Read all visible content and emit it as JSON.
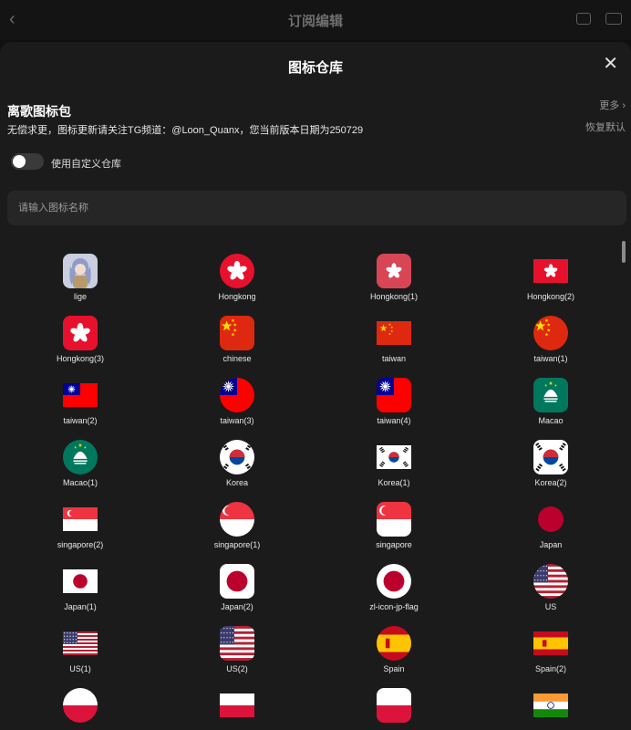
{
  "topbar": {
    "title": "订阅编辑"
  },
  "sheet": {
    "title": "图标仓库",
    "pack_title": "离歌图标包",
    "pack_desc": "无偿求更，图标更新请关注TG频道：@Loon_Quanx，您当前版本日期为250729",
    "more": "更多",
    "reset": "恢复默认",
    "toggle_label": "使用自定义仓库",
    "toggle_on": false,
    "search_placeholder": "请输入图标名称"
  },
  "icons": [
    {
      "label": "lige",
      "kind": "avatar",
      "shape": "rounded"
    },
    {
      "label": "Hongkong",
      "kind": "hk",
      "shape": "circle"
    },
    {
      "label": "Hongkong(1)",
      "kind": "hk",
      "shape": "rounded",
      "bg": "#d84656"
    },
    {
      "label": "Hongkong(2)",
      "kind": "hk",
      "shape": "rect"
    },
    {
      "label": "Hongkong(3)",
      "kind": "hk",
      "shape": "rounded"
    },
    {
      "label": "chinese",
      "kind": "cn",
      "shape": "rounded"
    },
    {
      "label": "taiwan",
      "kind": "cn",
      "shape": "rect"
    },
    {
      "label": "taiwan(1)",
      "kind": "cn",
      "shape": "circle"
    },
    {
      "label": "taiwan(2)",
      "kind": "tw",
      "shape": "rect"
    },
    {
      "label": "taiwan(3)",
      "kind": "tw",
      "shape": "circle"
    },
    {
      "label": "taiwan(4)",
      "kind": "tw",
      "shape": "rounded"
    },
    {
      "label": "Macao",
      "kind": "mo",
      "shape": "rounded"
    },
    {
      "label": "Macao(1)",
      "kind": "mo",
      "shape": "circle"
    },
    {
      "label": "Korea",
      "kind": "kr",
      "shape": "circle"
    },
    {
      "label": "Korea(1)",
      "kind": "kr",
      "shape": "rect"
    },
    {
      "label": "Korea(2)",
      "kind": "kr",
      "shape": "rounded"
    },
    {
      "label": "singapore(2)",
      "kind": "sg",
      "shape": "rect"
    },
    {
      "label": "singapore(1)",
      "kind": "sg",
      "shape": "circle"
    },
    {
      "label": "singapore",
      "kind": "sg",
      "shape": "rounded"
    },
    {
      "label": "Japan",
      "kind": "jp-dot",
      "shape": "none"
    },
    {
      "label": "Japan(1)",
      "kind": "jp",
      "shape": "rect"
    },
    {
      "label": "Japan(2)",
      "kind": "jp",
      "shape": "rounded"
    },
    {
      "label": "zl-icon-jp-flag",
      "kind": "jp",
      "shape": "circle"
    },
    {
      "label": "US",
      "kind": "us",
      "shape": "circle"
    },
    {
      "label": "US(1)",
      "kind": "us",
      "shape": "rect"
    },
    {
      "label": "US(2)",
      "kind": "us",
      "shape": "rounded"
    },
    {
      "label": "Spain",
      "kind": "es",
      "shape": "circle"
    },
    {
      "label": "Spain(2)",
      "kind": "es",
      "shape": "rect"
    },
    {
      "label": "",
      "kind": "pl",
      "shape": "circle"
    },
    {
      "label": "",
      "kind": "pl",
      "shape": "rect"
    },
    {
      "label": "",
      "kind": "pl",
      "shape": "rounded"
    },
    {
      "label": "",
      "kind": "in",
      "shape": "rect"
    }
  ],
  "colors": {
    "red": "#de2910",
    "hk_red": "#e8112d",
    "tw_blue": "#000095",
    "mo_green": "#00785e",
    "kr_red": "#cd2e3a",
    "kr_blue": "#0047a0",
    "sg_red": "#ef3340",
    "jp_red": "#bc002d",
    "us_red": "#b22234",
    "us_blue": "#3c3b6e",
    "es_red": "#c60b1e",
    "es_yellow": "#ffc400",
    "pl_red": "#dc143c",
    "in_saffron": "#ff9933",
    "in_green": "#138808"
  }
}
